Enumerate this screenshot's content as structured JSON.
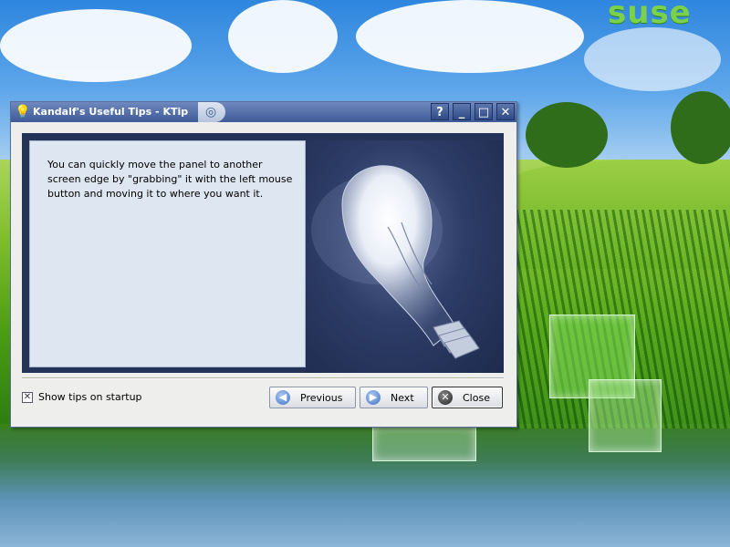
{
  "desktop": {
    "brand_logo": "suse"
  },
  "window": {
    "title": "Kandalf's Useful Tips - KTip",
    "title_icon": "lightbulb-icon",
    "buttons": {
      "help": "?",
      "minimize": "_",
      "maximize": "□",
      "close": "✕"
    }
  },
  "tip": {
    "text": "You can quickly move the panel to another screen edge by \"grabbing\" it with the left mouse button and moving it to where you want it."
  },
  "footer": {
    "show_tips_label": "Show tips on startup",
    "show_tips_checked": true,
    "previous_label": "Previous",
    "next_label": "Next",
    "close_label": "Close"
  },
  "colors": {
    "titlebar": "#3e5a97",
    "content_bg": "#253359",
    "tip_panel_bg": "#dde6f1"
  }
}
